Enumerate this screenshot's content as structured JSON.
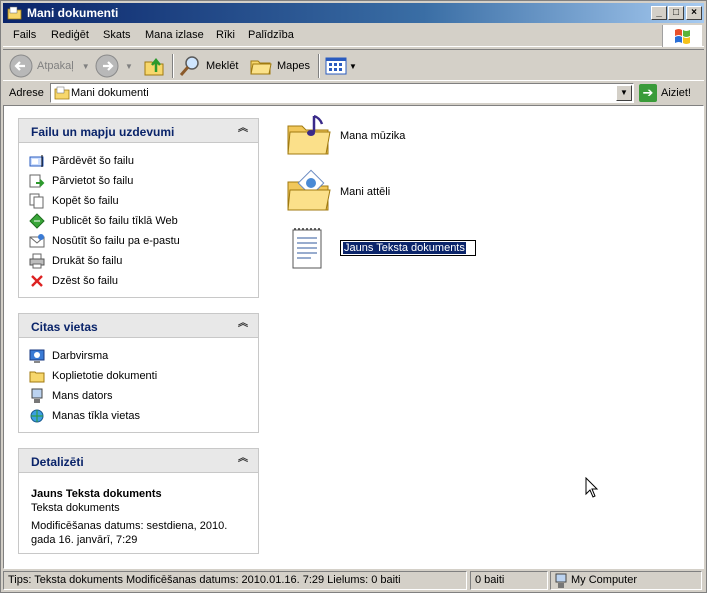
{
  "window": {
    "title": "Mani dokumenti"
  },
  "menu": [
    "Fails",
    "Rediģēt",
    "Skats",
    "Mana izlase",
    "Rīki",
    "Palīdzība"
  ],
  "toolbar": {
    "back": "Atpakaļ",
    "search": "Meklēt",
    "folders": "Mapes"
  },
  "address": {
    "label": "Adrese",
    "value": "Mani dokumenti",
    "go": "Aiziet!"
  },
  "panels": {
    "tasks": {
      "title": "Failu un mapju uzdevumi",
      "items": [
        {
          "label": "Pārdēvēt šo failu",
          "icon": "rename-icon"
        },
        {
          "label": "Pārvietot šo failu",
          "icon": "move-icon"
        },
        {
          "label": "Kopēt šo failu",
          "icon": "copy-icon"
        },
        {
          "label": "Publicēt šo failu tīklā Web",
          "icon": "publish-web-icon"
        },
        {
          "label": "Nosūtīt šo failu pa e-pastu",
          "icon": "email-icon"
        },
        {
          "label": "Drukāt šo failu",
          "icon": "print-icon"
        },
        {
          "label": "Dzēst šo failu",
          "icon": "delete-icon"
        }
      ]
    },
    "places": {
      "title": "Citas vietas",
      "items": [
        {
          "label": "Darbvirsma",
          "icon": "desktop-icon"
        },
        {
          "label": "Koplietotie dokumenti",
          "icon": "folder-icon"
        },
        {
          "label": "Mans dators",
          "icon": "computer-icon"
        },
        {
          "label": "Manas tīkla vietas",
          "icon": "network-icon"
        }
      ]
    },
    "details": {
      "title": "Detalizēti",
      "name": "Jauns Teksta dokuments",
      "type": "Teksta dokuments",
      "modified_line1": "Modificēšanas datums: sestdiena, 2010.",
      "modified_line2": "gada 16. janvārī, 7:29"
    }
  },
  "files": [
    {
      "label": "Mana mūzika",
      "icon": "music-folder-icon"
    },
    {
      "label": "Mani attēli",
      "icon": "pictures-folder-icon"
    },
    {
      "label": "Jauns Teksta dokuments",
      "icon": "text-document-icon",
      "renaming": true
    }
  ],
  "status": {
    "tip": "Tips: Teksta dokuments Modificēšanas datums: 2010.01.16. 7:29 Lielums: 0 baiti",
    "size": "0 baiti",
    "zone": "My Computer"
  }
}
